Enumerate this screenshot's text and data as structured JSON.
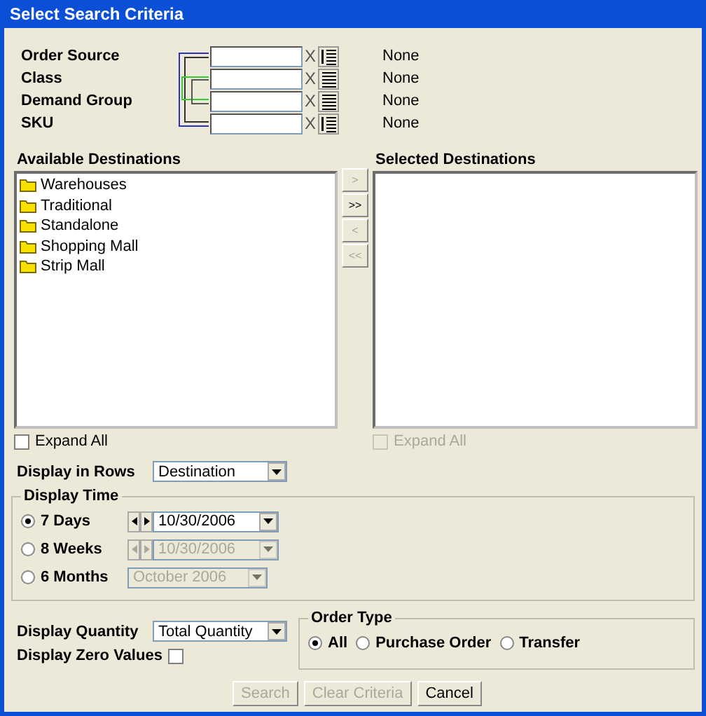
{
  "window": {
    "title": "Select Search Criteria"
  },
  "criteria": [
    {
      "label": "Order Source",
      "clear_glyph": "X",
      "value_text": "None",
      "kind": "numbered"
    },
    {
      "label": "Class",
      "clear_glyph": "X",
      "value_text": "None",
      "kind": "plain"
    },
    {
      "label": "Demand Group",
      "clear_glyph": "X",
      "value_text": "None",
      "kind": "plain"
    },
    {
      "label": "SKU",
      "clear_glyph": "X",
      "value_text": "None",
      "kind": "numbered"
    }
  ],
  "available": {
    "title": "Available Destinations",
    "items": [
      {
        "label": "Warehouses"
      },
      {
        "label": "Traditional"
      },
      {
        "label": "Standalone"
      },
      {
        "label": "Shopping Mall"
      },
      {
        "label": "Strip Mall"
      }
    ],
    "expand_all": {
      "label": "Expand All",
      "checked": false,
      "disabled": false
    }
  },
  "transfer_buttons": [
    {
      "label": ">",
      "disabled": true
    },
    {
      "label": ">>",
      "disabled": false
    },
    {
      "label": "<",
      "disabled": true
    },
    {
      "label": "<<",
      "disabled": true
    }
  ],
  "selected": {
    "title": "Selected Destinations",
    "expand_all": {
      "label": "Expand All",
      "checked": false,
      "disabled": true
    }
  },
  "display_rows": {
    "label": "Display in Rows",
    "value": "Destination"
  },
  "display_time": {
    "title": "Display Time",
    "options": [
      {
        "label": "7 Days",
        "selected": true,
        "kind": "stepper",
        "value": "10/30/2006",
        "disabled": false
      },
      {
        "label": "8 Weeks",
        "selected": false,
        "kind": "stepper",
        "value": "10/30/2006",
        "disabled": true
      },
      {
        "label": "6 Months",
        "selected": false,
        "kind": "plain",
        "value": "October 2006",
        "disabled": true
      }
    ]
  },
  "display_quantity": {
    "label": "Display Quantity",
    "value": "Total Quantity"
  },
  "zero_values": {
    "label": "Display Zero Values",
    "checked": false
  },
  "order_type": {
    "title": "Order Type",
    "options": [
      {
        "label": "All",
        "selected": true
      },
      {
        "label": "Purchase Order",
        "selected": false
      },
      {
        "label": "Transfer",
        "selected": false
      }
    ]
  },
  "buttons": [
    {
      "label": "Search",
      "disabled": true
    },
    {
      "label": "Clear Criteria",
      "disabled": true
    },
    {
      "label": "Cancel",
      "disabled": false
    }
  ]
}
